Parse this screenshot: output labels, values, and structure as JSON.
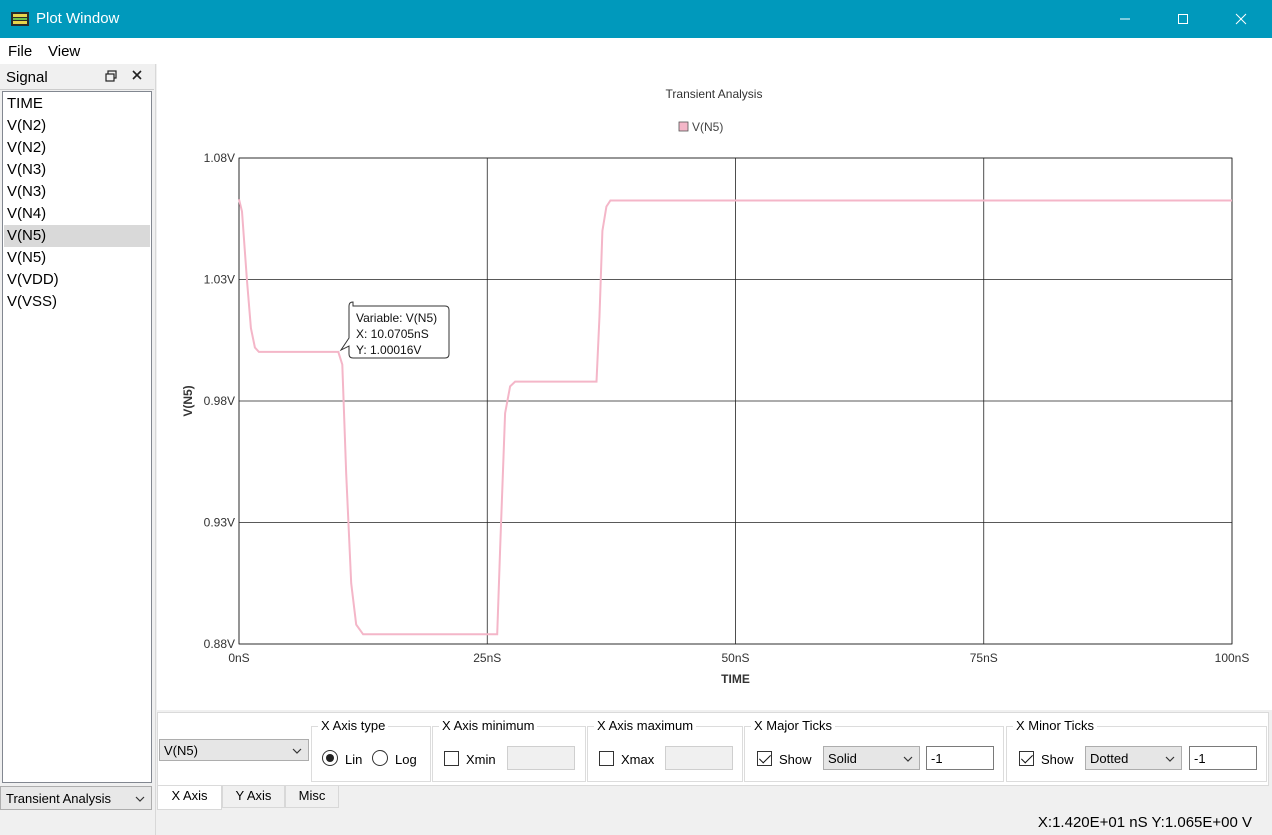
{
  "window": {
    "title": "Plot Window"
  },
  "menu": {
    "file": "File",
    "view": "View"
  },
  "signal_panel": {
    "title": "Signal",
    "items": [
      "TIME",
      "V(N2)",
      "V(N2)",
      "V(N3)",
      "V(N3)",
      "V(N4)",
      "V(N5)",
      "V(N5)",
      "V(VDD)",
      "V(VSS)"
    ],
    "selected_index": 6,
    "analysis_select": "Transient Analysis"
  },
  "chart_data": {
    "type": "line",
    "title": "Transient Analysis",
    "xlabel": "TIME",
    "ylabel": "V(N5)",
    "xlim": [
      0,
      100
    ],
    "ylim": [
      0.88,
      1.08
    ],
    "xticks": [
      "0nS",
      "25nS",
      "50nS",
      "75nS",
      "100nS"
    ],
    "yticks": [
      "1.08V",
      "1.03V",
      "0.98V",
      "0.93V",
      "0.88V"
    ],
    "grid": true,
    "legend": "top-center",
    "series": [
      {
        "name": "V(N5)",
        "color": "#f4b6c8",
        "x": [
          0,
          0.3,
          0.8,
          1.2,
          1.6,
          2.0,
          10.0,
          10.4,
          10.8,
          11.3,
          11.8,
          12.5,
          26.0,
          26.3,
          26.8,
          27.3,
          27.8,
          36.0,
          36.3,
          36.6,
          37.0,
          37.4,
          100
        ],
        "y": [
          1.063,
          1.058,
          1.03,
          1.01,
          1.002,
          1.0002,
          1.0002,
          0.995,
          0.95,
          0.905,
          0.888,
          0.884,
          0.884,
          0.92,
          0.975,
          0.986,
          0.988,
          0.988,
          1.015,
          1.05,
          1.06,
          1.0625,
          1.0625
        ]
      }
    ],
    "tooltip": {
      "lines": [
        "Variable: V(N5)",
        "X: 10.0705nS",
        "Y: 1.00016V"
      ],
      "x": 10.0705,
      "y": 1.00016
    }
  },
  "controls": {
    "variable_select": "V(N5)",
    "x_axis_type": {
      "title": "X Axis type",
      "lin": "Lin",
      "log": "Log",
      "selected": "Lin"
    },
    "x_axis_min": {
      "title": "X Axis minimum",
      "label": "Xmin",
      "checked": false,
      "value": ""
    },
    "x_axis_max": {
      "title": "X Axis maximum",
      "label": "Xmax",
      "checked": false,
      "value": ""
    },
    "x_major_ticks": {
      "title": "X Major Ticks",
      "show_label": "Show",
      "checked": true,
      "style": "Solid",
      "value": "-1"
    },
    "x_minor_ticks": {
      "title": "X Minor Ticks",
      "show_label": "Show",
      "checked": true,
      "style": "Dotted",
      "value": "-1"
    }
  },
  "tabs": [
    "X Axis",
    "Y Axis",
    "Misc"
  ],
  "active_tab": "X Axis",
  "status": "X:1.420E+01 nS Y:1.065E+00 V"
}
